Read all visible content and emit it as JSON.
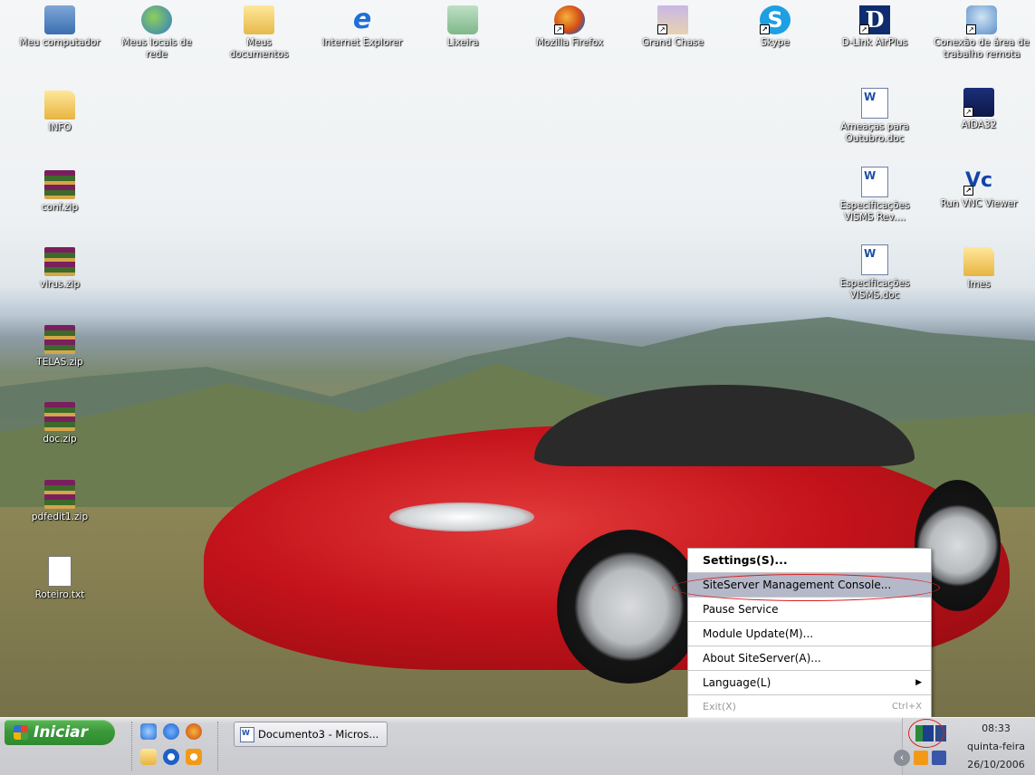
{
  "desktop": {
    "icons": [
      {
        "label": "Meu computador",
        "icon": "my-computer-icon"
      },
      {
        "label": "Meus locais de rede",
        "icon": "network-places-icon"
      },
      {
        "label": "Meus documentos",
        "icon": "my-documents-icon"
      },
      {
        "label": "Internet Explorer",
        "icon": "internet-explorer-icon"
      },
      {
        "label": "Lixeira",
        "icon": "recycle-bin-icon"
      },
      {
        "label": "Mozilla Firefox",
        "icon": "firefox-icon"
      },
      {
        "label": "Grand Chase",
        "icon": "grand-chase-icon"
      },
      {
        "label": "Skype",
        "icon": "skype-icon"
      },
      {
        "label": "D-Link AirPlus",
        "icon": "dlink-icon"
      },
      {
        "label": "Conexão de área de trabalho remota",
        "icon": "remote-desktop-icon"
      },
      {
        "label": "INFO",
        "icon": "folder-icon"
      },
      {
        "label": "conf.zip",
        "icon": "zip-archive-icon"
      },
      {
        "label": "virus.zip",
        "icon": "zip-archive-icon"
      },
      {
        "label": "TELAS.zip",
        "icon": "zip-archive-icon"
      },
      {
        "label": "doc.zip",
        "icon": "zip-archive-icon"
      },
      {
        "label": "pdfedit1.zip",
        "icon": "zip-archive-icon"
      },
      {
        "label": "Roteiro.txt",
        "icon": "text-file-icon"
      },
      {
        "label": "Ameaças para Outubro.doc",
        "icon": "word-document-icon"
      },
      {
        "label": "AIDA32",
        "icon": "aida32-icon"
      },
      {
        "label": "Especificações VISMS Rev....",
        "icon": "word-document-icon"
      },
      {
        "label": "Run VNC Viewer",
        "icon": "vnc-icon"
      },
      {
        "label": "Especificações VISMS.doc",
        "icon": "word-document-icon"
      },
      {
        "label": "Imes",
        "icon": "folder-icon"
      }
    ]
  },
  "context_menu": {
    "items": [
      {
        "label": "Settings(S)...",
        "style": "bold"
      },
      {
        "label": "SiteServer Management Console...",
        "style": "highlighted"
      },
      {
        "label": "Pause Service"
      },
      {
        "label": "Module Update(M)..."
      },
      {
        "label": "About SiteServer(A)..."
      },
      {
        "label": "Language(L)",
        "submenu": true
      },
      {
        "label": "Exit(X)",
        "shortcut": "Ctrl+X",
        "disabled": true
      }
    ]
  },
  "taskbar": {
    "start_label": "Iniciar",
    "task_button": "Documento3 - Micros...",
    "clock": {
      "time": "08:33",
      "weekday": "quinta-feira",
      "date": "26/10/2006"
    }
  },
  "colors": {
    "menu_highlight": "#b5b8c9",
    "annotation_circle": "#d62020",
    "start_button": "#3a9a3a"
  }
}
